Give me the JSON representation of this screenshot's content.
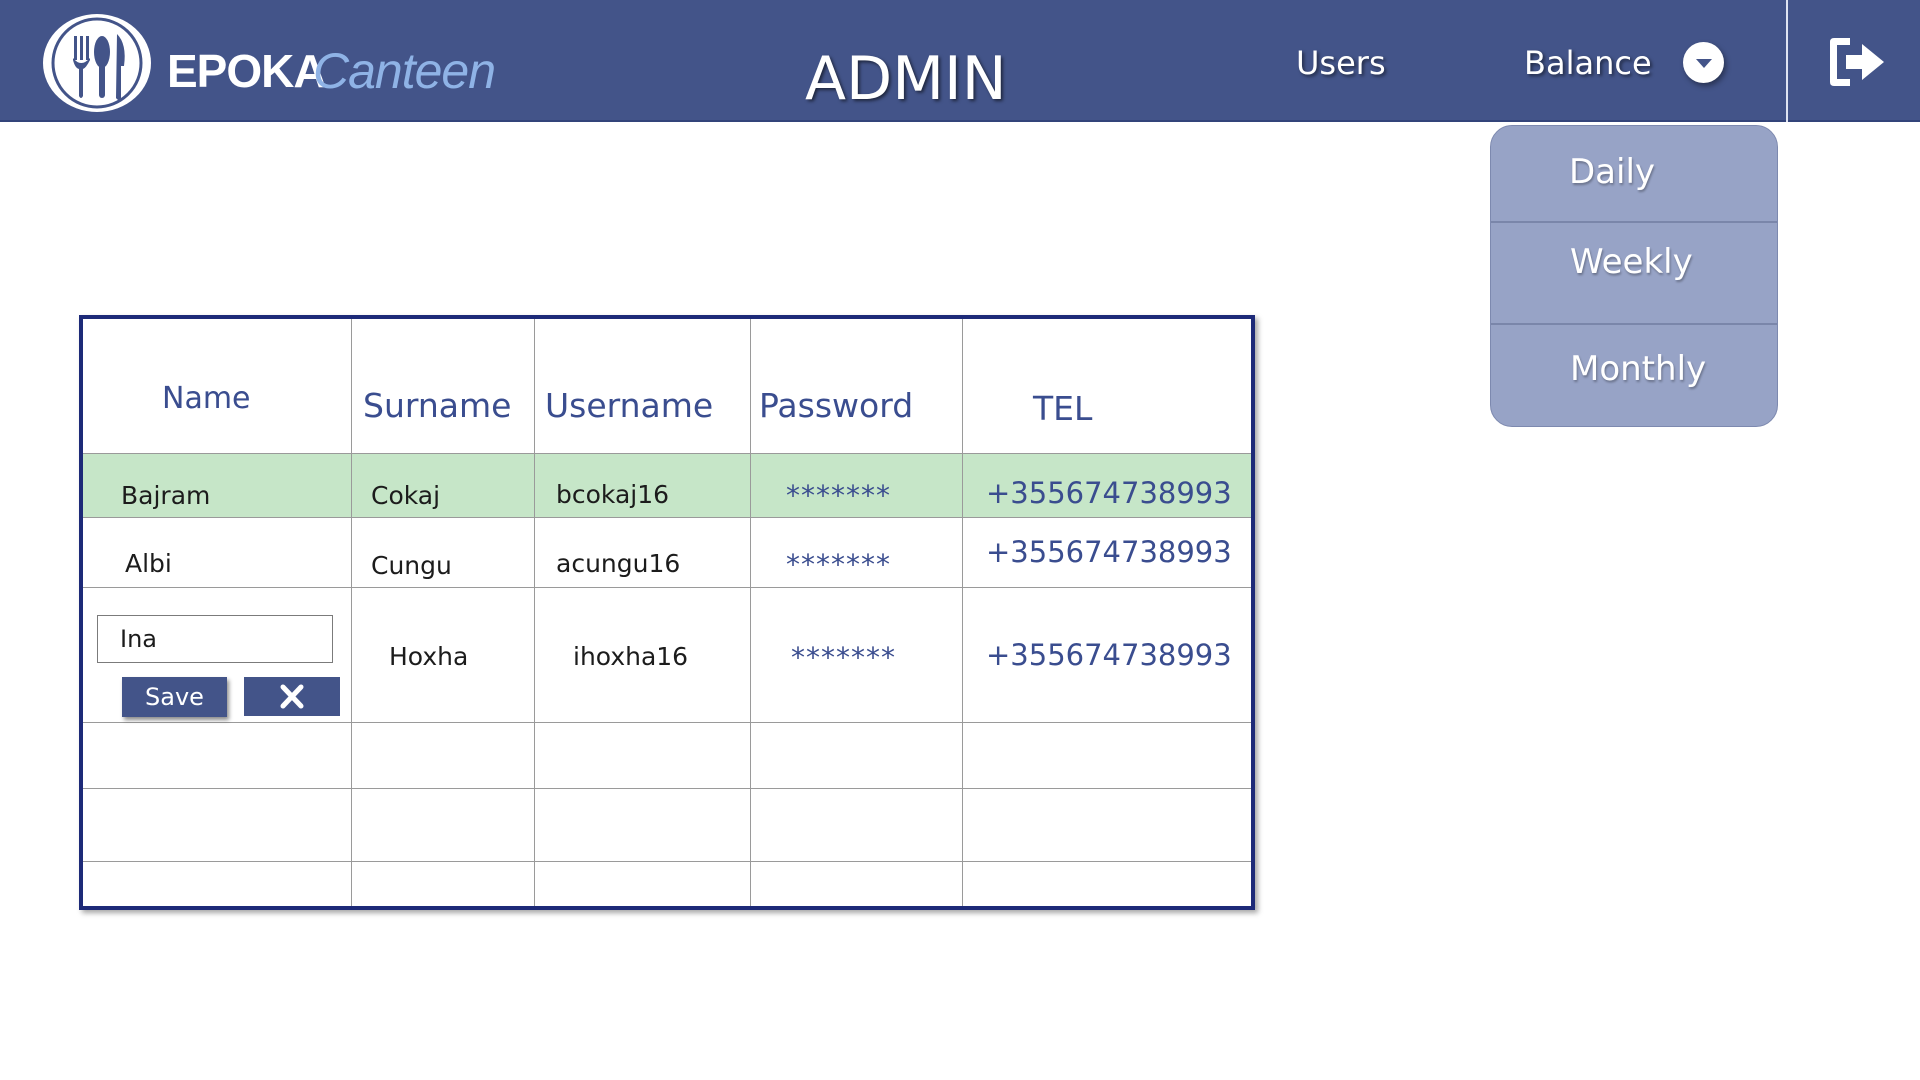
{
  "header": {
    "brand_epoka": "EPOKA",
    "brand_canteen": "Canteen",
    "title": "ADMIN",
    "nav_users": "Users",
    "nav_balance": "Balance"
  },
  "balance_menu": {
    "items": [
      "Daily",
      "Weekly",
      "Monthly"
    ]
  },
  "table": {
    "headers": [
      "Name",
      "Surname",
      "Username",
      "Password",
      "TEL"
    ],
    "rows": [
      {
        "name": "Bajram",
        "surname": "Cokaj",
        "username": "bcokaj16",
        "password": "*******",
        "tel": "+355674738993",
        "selected": true
      },
      {
        "name": "Albi",
        "surname": "Cungu",
        "username": "acungu16",
        "password": "*******",
        "tel": "+355674738993"
      },
      {
        "name": "Ina",
        "surname": "Hoxha",
        "username": "ihoxha16",
        "password": "*******",
        "tel": "+355674738993",
        "editing": true
      }
    ],
    "save_label": "Save"
  },
  "icons": {
    "logo": "fork-spoon-knife-icon",
    "balance_toggle": "chevron-down-icon",
    "logout": "logout-icon",
    "cancel": "close-icon"
  },
  "colors": {
    "header_bg": "#435489",
    "dropdown_bg": "#97a3c6",
    "selected_row": "#c6e6c8",
    "accent_text": "#3a4d8f",
    "table_border": "#1d2a78"
  }
}
